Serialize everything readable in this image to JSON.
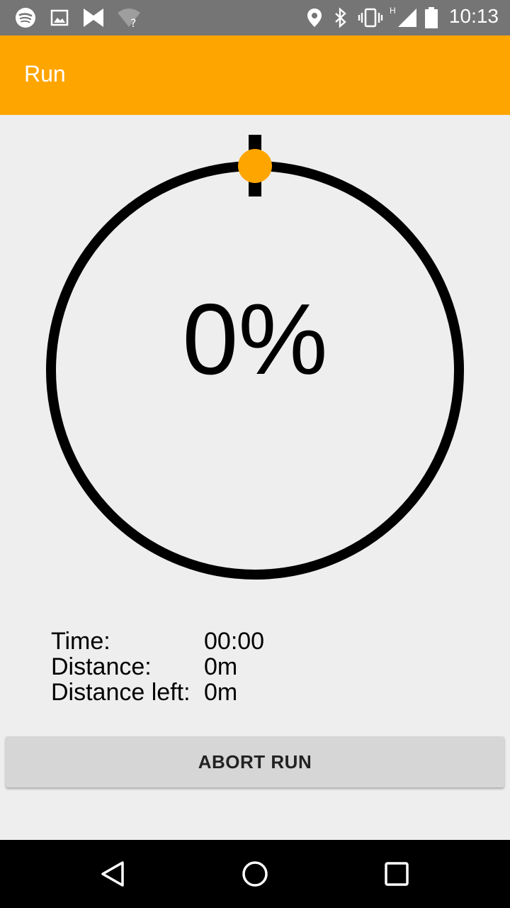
{
  "status_bar": {
    "time": "10:13",
    "network_type": "H",
    "left_icons": [
      "spotify-icon",
      "image-icon",
      "bowtie-app-icon",
      "wifi-unknown-icon"
    ],
    "right_icons": [
      "location-icon",
      "bluetooth-icon",
      "vibrate-icon",
      "signal-icon",
      "battery-icon"
    ]
  },
  "app_bar": {
    "title": "Run"
  },
  "progress": {
    "percent_text": "0%",
    "fraction": 0.0
  },
  "stats": {
    "time_label": "Time:",
    "time_value": "00:00",
    "distance_label": "Distance:",
    "distance_value": "0m",
    "distance_left_label": "Distance left:",
    "distance_left_value": "0m"
  },
  "abort_button": {
    "label": "ABORT RUN"
  },
  "colors": {
    "accent": "#ffa500",
    "status_bar": "#757575",
    "background": "#eeeeee"
  },
  "nav_bar": {
    "icons": [
      "back-icon",
      "home-icon",
      "recents-icon"
    ]
  }
}
